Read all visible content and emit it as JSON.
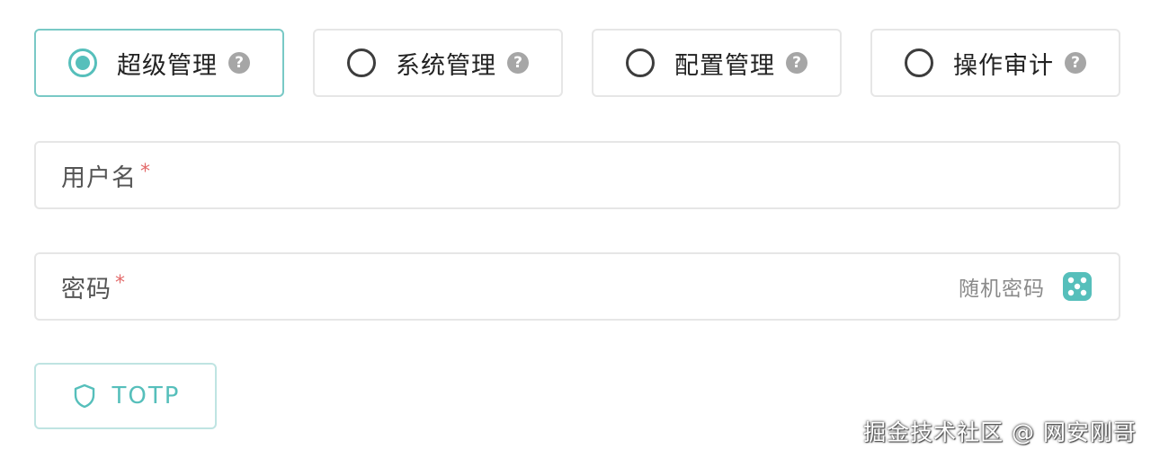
{
  "roles": [
    {
      "label": "超级管理",
      "selected": true
    },
    {
      "label": "系统管理",
      "selected": false
    },
    {
      "label": "配置管理",
      "selected": false
    },
    {
      "label": "操作审计",
      "selected": false
    }
  ],
  "help_glyph": "?",
  "username": {
    "label": "用户名",
    "required_mark": "*",
    "value": ""
  },
  "password": {
    "label": "密码",
    "required_mark": "*",
    "value": "",
    "random_label": "随机密码"
  },
  "totp": {
    "label": "TOTP"
  },
  "watermark": "掘金技术社区 @ 网安刚哥",
  "colors": {
    "accent": "#56bfbb",
    "border": "#e6e6e6",
    "required": "#e36a6a"
  }
}
